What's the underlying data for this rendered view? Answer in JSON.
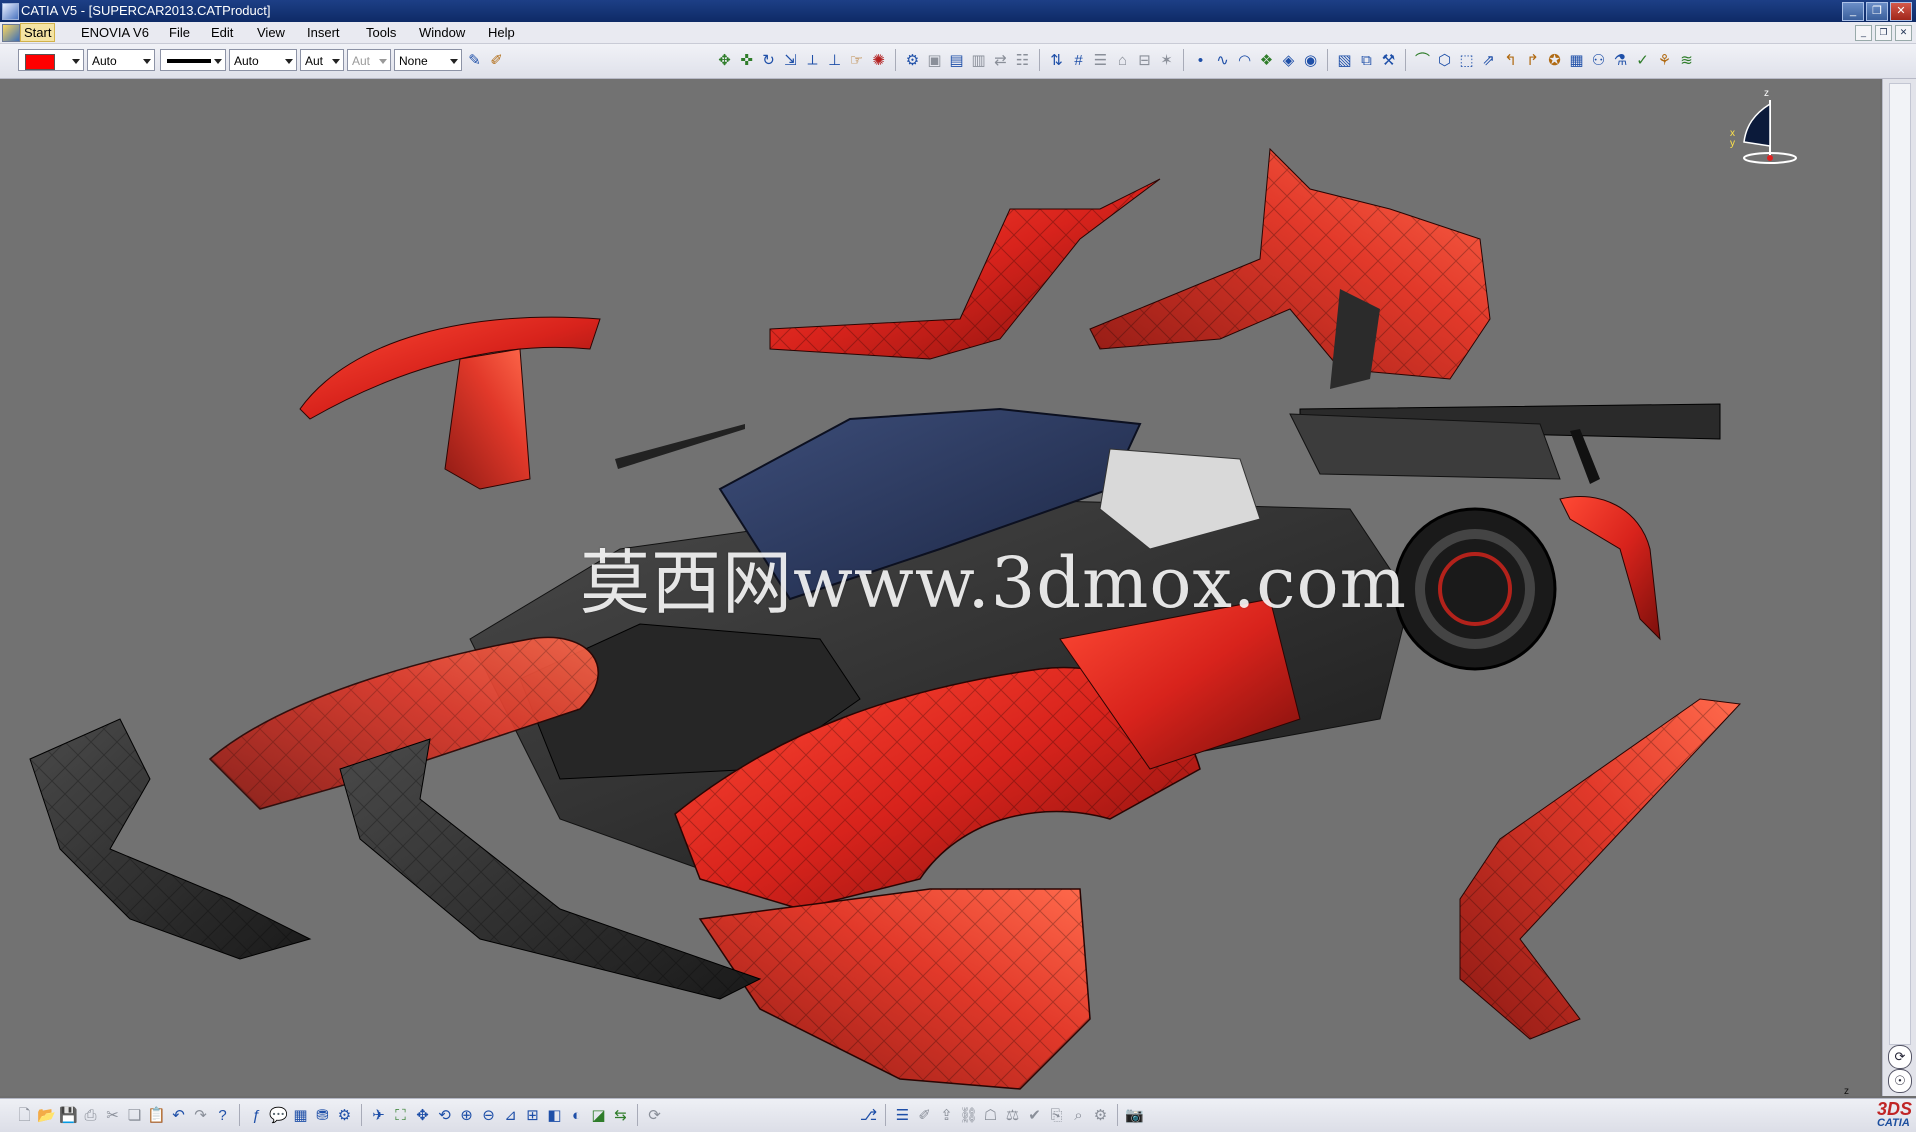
{
  "window": {
    "title": "CATIA V5 - [SUPERCAR2013.CATProduct]",
    "controls": [
      "_",
      "❐",
      "✕"
    ]
  },
  "menu": {
    "items": [
      "Start",
      "ENOVIA V6",
      "File",
      "Edit",
      "View",
      "Insert",
      "Tools",
      "Window",
      "Help"
    ],
    "active": "Start",
    "mdi_controls": [
      "_",
      "❐",
      "✕"
    ]
  },
  "properties_toolbar": {
    "color_swatch": "#ff0000",
    "transparency": "Auto",
    "line_weight": "Auto",
    "line_type": "Aut",
    "point_symbol": "Aut",
    "layer": "None"
  },
  "viewport": {
    "watermark": "莫西网www.3dmox.com",
    "compass": {
      "z_label": "z",
      "x_label": "x",
      "y_label": "y"
    },
    "mini_axis": {
      "z_label": "z",
      "x_label": "x"
    },
    "background": "#727272",
    "body_color": "#d8231c"
  },
  "branding": {
    "logo_text": "CATIA",
    "logo_mark": "3DS"
  },
  "icons": {
    "top_right": [
      "move-icon",
      "pan-icon",
      "rotate-icon",
      "snap-icon",
      "measure-icon",
      "constraint-icon",
      "manipulate-icon",
      "explode-icon",
      "assembly-icon",
      "product-icon",
      "component-icon",
      "insert-part-icon",
      "replace-icon",
      "graph-icon",
      "reorder-icon",
      "numbering-icon",
      "bom-icon",
      "scene-icon",
      "section-icon",
      "clash-icon",
      "point-icon",
      "curve-icon",
      "circle-icon",
      "spline-icon",
      "surface-icon",
      "sweep-icon",
      "fill-icon",
      "blend-icon",
      "join-icon",
      "split-icon",
      "trim-icon",
      "fillet-icon",
      "translate-icon",
      "scaling-icon",
      "render-icon",
      "apply-material-icon",
      "layer-icon"
    ],
    "bottom": [
      "new-icon",
      "open-icon",
      "save-icon",
      "print-icon",
      "cut-icon",
      "copy-icon",
      "paste-icon",
      "undo-icon",
      "redo-icon",
      "whats-this-icon",
      "formula-icon",
      "comment-icon",
      "table-icon",
      "catalog-icon",
      "macro-icon",
      "fly-mode-icon",
      "fit-all-icon",
      "pan-view-icon",
      "rotate-view-icon",
      "zoom-in-icon",
      "zoom-out-icon",
      "normal-view-icon",
      "multi-view-icon",
      "iso-view-icon",
      "shading-icon",
      "hide-show-icon",
      "swap-space-icon",
      "update-icon",
      "update-all-icon",
      "properties-icon",
      "sketch-icon",
      "publish-icon",
      "link-icon",
      "knowledge-icon",
      "rule-icon",
      "check-icon",
      "report-icon",
      "camera-icon"
    ]
  }
}
